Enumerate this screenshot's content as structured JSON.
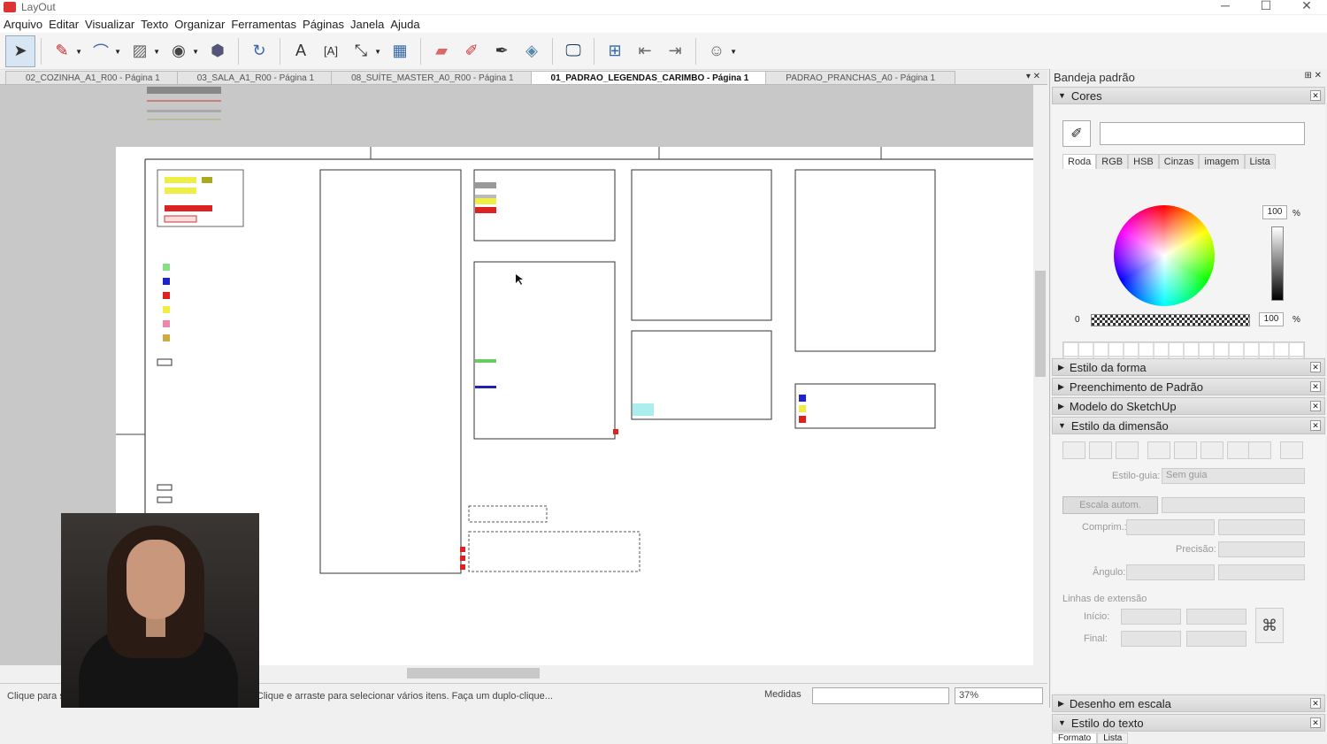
{
  "app": {
    "title": "LayOut"
  },
  "menu": [
    "Arquivo",
    "Editar",
    "Visualizar",
    "Texto",
    "Organizar",
    "Ferramentas",
    "Páginas",
    "Janela",
    "Ajuda"
  ],
  "tabs": [
    {
      "label": "02_COZINHA_A1_R00 - Página 1",
      "active": false
    },
    {
      "label": "03_SALA_A1_R00 - Página 1",
      "active": false
    },
    {
      "label": "08_SUÍTE_MASTER_A0_R00 - Página 1",
      "active": false
    },
    {
      "label": "01_PADRAO_LEGENDAS_CARIMBO - Página 1",
      "active": true
    },
    {
      "label": "PADRAO_PRANCHAS_A0 - Página 1",
      "active": false
    }
  ],
  "panel": {
    "title": "Bandeja padrão",
    "cores": {
      "title": "Cores",
      "tabs": [
        "Roda",
        "RGB",
        "HSB",
        "Cinzas",
        "imagem",
        "Lista"
      ],
      "active_tab": "Roda",
      "brightness": "100",
      "opacity": "100",
      "opacity_min": "0",
      "pct": "%"
    },
    "sections": [
      "Estilo da forma",
      "Preenchimento de Padrão",
      "Modelo do SketchUp"
    ],
    "dimension": {
      "title": "Estilo da dimensão",
      "guide_label": "Estilo-guia:",
      "guide_value": "Sem guia",
      "scale_button": "Escala autom.",
      "length_label": "Comprim.:",
      "precision_label": "Precisão:",
      "angle_label": "Ângulo:",
      "ext_lines_label": "Linhas de extensão",
      "start_label": "Início:",
      "end_label": "Final:"
    },
    "bottom_sections": [
      "Desenho em escala",
      "Estilo do texto"
    ],
    "text_tabs": [
      "Formato",
      "Lista"
    ]
  },
  "status": {
    "message": "Clique para se... ne Shift e clique para ampliar a seleção. Clique e arraste para selecionar vários itens. Faça um duplo-clique...",
    "measures_label": "Medidas",
    "zoom": "37%"
  }
}
